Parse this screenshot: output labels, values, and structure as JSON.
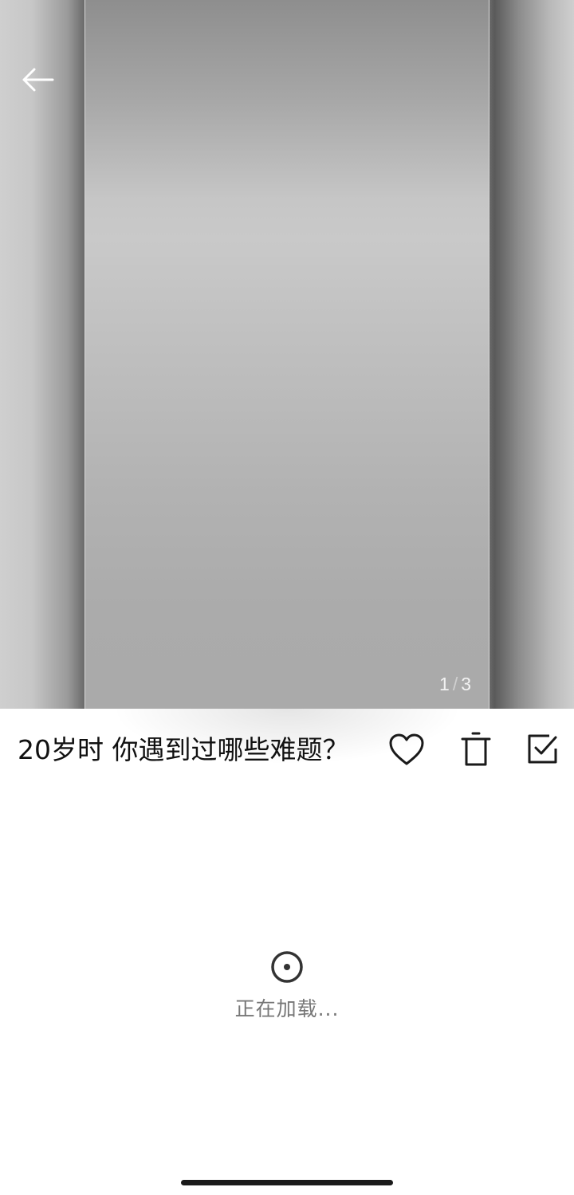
{
  "viewer": {
    "page_current": "1",
    "page_separator": "/",
    "page_total": "3"
  },
  "post": {
    "title": "20岁时 你遇到过哪些难题？"
  },
  "actions": {
    "back_icon": "arrow-left-icon",
    "like_icon": "heart-outline-icon",
    "delete_icon": "trash-icon",
    "select_icon": "checkbox-checked-icon"
  },
  "loading": {
    "text": "正在加载...",
    "icon": "spinner-icon"
  },
  "colors": {
    "title_text": "#111111",
    "loading_text": "#777777",
    "icon_dark": "#1a1a1a",
    "indicator_text": "#f2f2f2"
  }
}
